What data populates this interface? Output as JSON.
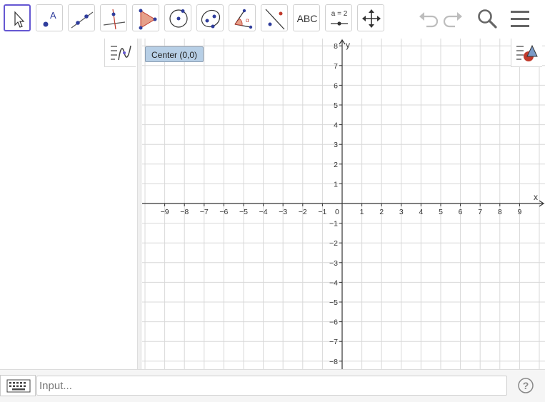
{
  "toolbar": {
    "tools": [
      {
        "name": "move-tool",
        "selected": true
      },
      {
        "name": "point-tool"
      },
      {
        "name": "line-tool"
      },
      {
        "name": "perpendicular-line-tool"
      },
      {
        "name": "polygon-tool"
      },
      {
        "name": "circle-tool"
      },
      {
        "name": "ellipse-tool"
      },
      {
        "name": "angle-tool"
      },
      {
        "name": "reflect-tool"
      },
      {
        "name": "text-tool",
        "label": "ABC"
      },
      {
        "name": "slider-tool",
        "label": "a = 2"
      },
      {
        "name": "move-graphics-view-tool"
      }
    ],
    "undo_icon": "undo-icon",
    "redo_icon": "redo-icon",
    "search_icon": "search-icon",
    "menu_icon": "menu-icon"
  },
  "graphics": {
    "center_button_label": "Center (0,0)",
    "x_axis_label": "x",
    "y_axis_label": "y",
    "x_ticks": [
      "−9",
      "−8",
      "−7",
      "−6",
      "−5",
      "−4",
      "−3",
      "−2",
      "−1",
      "0",
      "1",
      "2",
      "3",
      "4",
      "5",
      "6",
      "7",
      "8",
      "9"
    ],
    "y_ticks": [
      "8",
      "7",
      "6",
      "5",
      "4",
      "3",
      "2",
      "1",
      "−1",
      "−2",
      "−3",
      "−4",
      "−5",
      "−6",
      "−7",
      "−8"
    ],
    "x_range": [
      -10,
      10
    ],
    "y_range": [
      -8,
      8
    ],
    "grid": true,
    "colors": {
      "grid": "#d8d8d8",
      "axis": "#333333",
      "accent": "#6557d2"
    }
  },
  "input_bar": {
    "placeholder": "Input...",
    "keyboard_icon": "keyboard-icon",
    "help_icon": "help-icon"
  }
}
